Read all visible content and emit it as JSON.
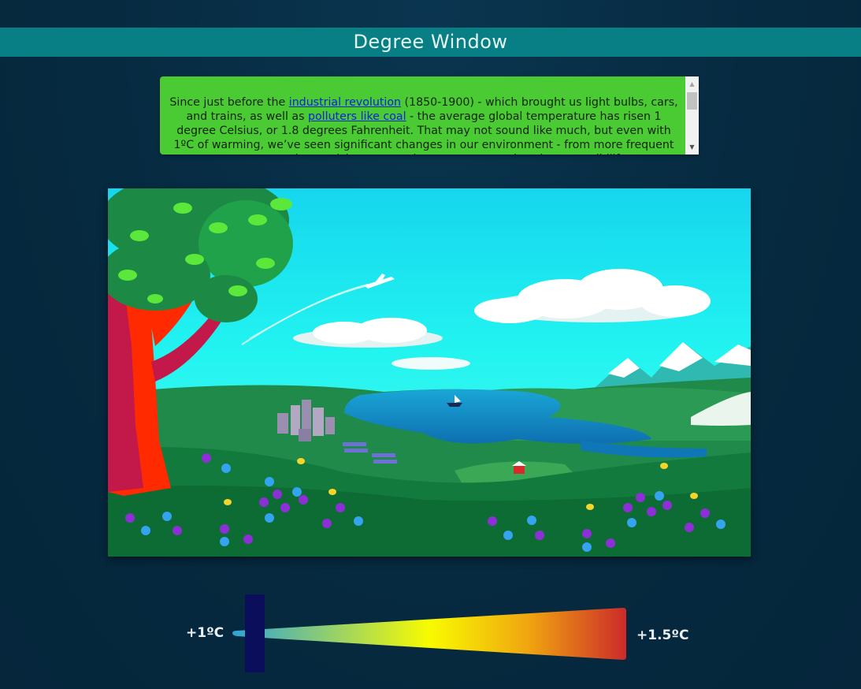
{
  "header": {
    "title": "Degree Window"
  },
  "info": {
    "t1": "Since just before the ",
    "link1": "industrial revolution",
    "t2": " (1850-1900) - which brought us light bulbs, cars, and trains, as well as ",
    "link2": "polluters like coal",
    "t3": " - the average global temperature has risen 1 degree Celsius, or 1.8 degrees Fahrenheit. That may not sound like much, but even with 1ºC of warming, we’ve seen significant changes in our environment - from more frequent extreme weather to rising seas and warmer oceans that threaten wildlife."
  },
  "slider": {
    "min_label": "+1ºC",
    "max_label": "+1.5ºC",
    "value_fraction": 0.0
  },
  "colors": {
    "background": "#062a40",
    "title_bar": "#087e85",
    "info_box": "#4acb33",
    "handle": "#0b0e5a",
    "ramp_start": "#2fa3d8",
    "ramp_mid": "#f8fb00",
    "ramp_end": "#cc2a2a"
  },
  "scroll_icons": {
    "up": "scroll-up-arrow-icon",
    "down": "scroll-down-arrow-icon"
  }
}
